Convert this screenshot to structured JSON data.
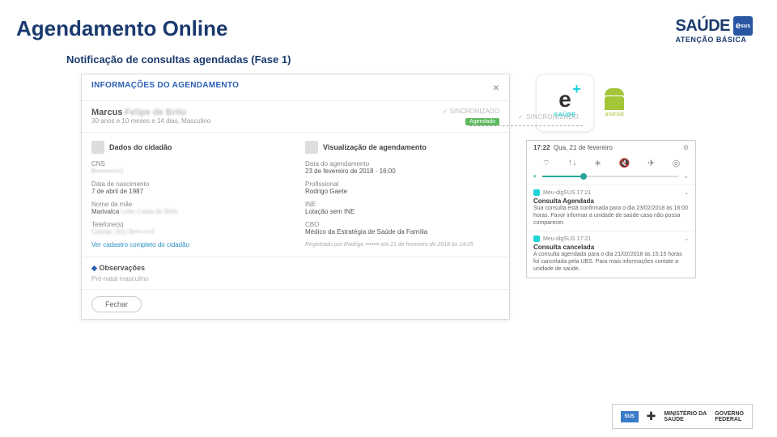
{
  "header": {
    "title": "Agendamento Online",
    "subtitle": "Notificação de consultas agendadas (Fase 1)",
    "logo_main": "SAÚDE",
    "logo_badge": "sus",
    "logo_sub": "ATENÇÃO BÁSICA",
    "logo_e": "e"
  },
  "modal": {
    "title": "INFORMAÇÕES DO AGENDAMENTO",
    "patient_name": "Marcus",
    "patient_name_blur": "Felipe de Brito",
    "patient_sub": "30 anos e 10 meses e 14 dias, Masculino",
    "sync": "SINCRONIZADO",
    "status": "Agendado",
    "left_title": "Dados do cidadão",
    "cns_label": "CNS",
    "cns_value": "8•••••••••••1",
    "dob_label": "Data de nascimento",
    "dob_value": "7 de abril de 1987",
    "mother_label": "Nome da mãe",
    "mother_value": "Marivalca",
    "mother_blur": "Leite Costa de Brito",
    "phone_label": "Telefone(s)",
    "phone_value": "Celular: (61) 9••••-•••3",
    "link": "Ver cadastro completo do cidadão",
    "right_title": "Visualização de agendamento",
    "date_label": "Data do agendamento",
    "date_value": "23 de fevereiro de 2018 - 16:00",
    "pro_label": "Profissional",
    "pro_value": "Rodrigo Gaete",
    "ine_label": "INE",
    "ine_value": "Lotação sem INE",
    "cbo_label": "CBO",
    "cbo_value": "Médico da Estratégia de Saúde da Família",
    "registered": "Registrado por Rodrigo ••••••• em 21 de fevereiro de 2018 às 14:25",
    "obs_title": "Observações",
    "obs_text": "Pré-natal masculino",
    "close_btn": "Fechar"
  },
  "apps": {
    "e_letter": "e",
    "e_plus": "+",
    "e_sub": "SAÚDE",
    "android": "android"
  },
  "phone": {
    "time": "17:22",
    "date": "Qua, 21 de fevereiro",
    "app1": "Meu-digSUS  17:21",
    "n1_title": "Consulta Agendada",
    "n1_body": "Sua consulta está confirmada para o dia 23/02/2018 às 16:00 horas. Favor informar a unidade de saúde caso não possa comparecer.",
    "app2": "Meu-digSUS  17:21",
    "n2_title": "Consulta cancelada",
    "n2_body": "A consulta agendada para o dia 21/02/2018 às 15:15 horas foi cancelada pela UBS. Para mais informações contate a unidade de saúde."
  },
  "sync_label": "SINCRONIZADO",
  "footer": {
    "sus": "SUS",
    "min1": "MINISTÉRIO DA",
    "min2": "SAÚDE",
    "gov1": "GOVERNO",
    "gov2": "FEDERAL"
  }
}
